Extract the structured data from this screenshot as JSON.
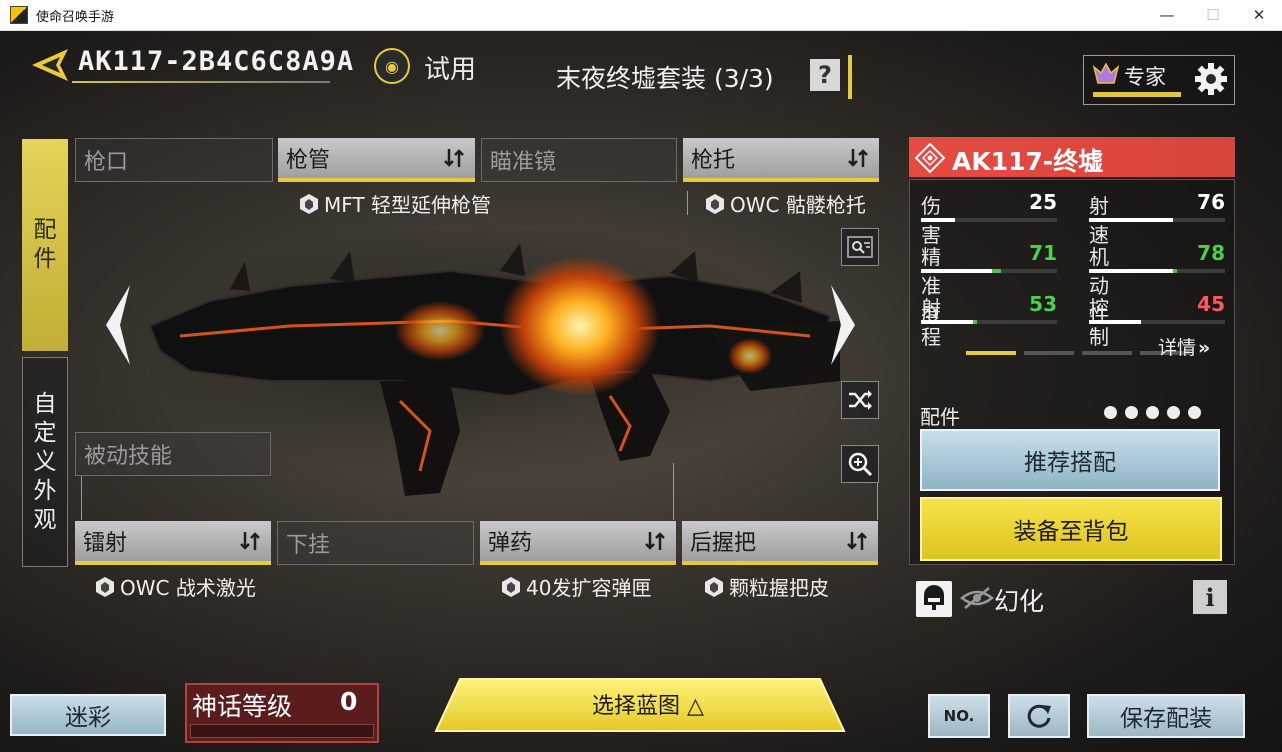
{
  "window": {
    "title": "使命召唤手游",
    "minimize": "—",
    "maximize": "☐",
    "close": "✕"
  },
  "header": {
    "weapon_name": "AK117-2B4C6C8A9A",
    "trial_label": "试用",
    "set_title": "末夜终墟套装 (3/3)",
    "help_label": "?",
    "expert_label": "专家"
  },
  "side_tabs": {
    "attachments": "配件",
    "custom_look": "自定义外观"
  },
  "slots": {
    "muzzle": {
      "label": "枪口"
    },
    "barrel": {
      "label": "枪管",
      "item": "MFT 轻型延伸枪管"
    },
    "optic": {
      "label": "瞄准镜"
    },
    "stock": {
      "label": "枪托",
      "item": "OWC 骷髅枪托"
    },
    "perk": {
      "label": "被动技能"
    },
    "laser": {
      "label": "镭射",
      "item": "OWC 战术激光"
    },
    "underbarrel": {
      "label": "下挂"
    },
    "ammo": {
      "label": "弹药",
      "item": "40发扩容弹匣"
    },
    "rear_grip": {
      "label": "后握把",
      "item": "颗粒握把皮"
    }
  },
  "weapon_title": "AK117-终墟",
  "stats": [
    {
      "label": "伤害",
      "value": "25",
      "fraction": 0.25,
      "gain": 0,
      "color": "#ffffff"
    },
    {
      "label": "射速",
      "value": "76",
      "fraction": 0.62,
      "gain": 0,
      "color": "#ffffff"
    },
    {
      "label": "精准度",
      "value": "71",
      "fraction": 0.52,
      "gain": 0.07,
      "color": "#4bd24b"
    },
    {
      "label": "机动性",
      "value": "78",
      "fraction": 0.62,
      "gain": 0.03,
      "color": "#4bd24b"
    },
    {
      "label": "射程",
      "value": "53",
      "fraction": 0.38,
      "gain": 0.03,
      "color": "#4bd24b"
    },
    {
      "label": "控制",
      "value": "45",
      "fraction": 0.38,
      "gain": 0,
      "color": "#ff5a5a"
    }
  ],
  "details_label": "详情",
  "attachments_label": "配件",
  "attachment_count": 5,
  "recommend_label": "推荐搭配",
  "equip_label": "装备至背包",
  "phantom_label": "幻化",
  "info_label": "i",
  "bottom": {
    "camo_label": "迷彩",
    "mythic_label": "神话等级",
    "mythic_value": "0",
    "blueprint_label": "选择蓝图 △",
    "no_label": "NO.",
    "save_label": "保存配装"
  },
  "colors": {
    "accent_yellow": "#e7cb3b",
    "stat_header_red": "#e64b41",
    "stat_green": "#4bd24b",
    "stat_red": "#ff5a5a"
  }
}
